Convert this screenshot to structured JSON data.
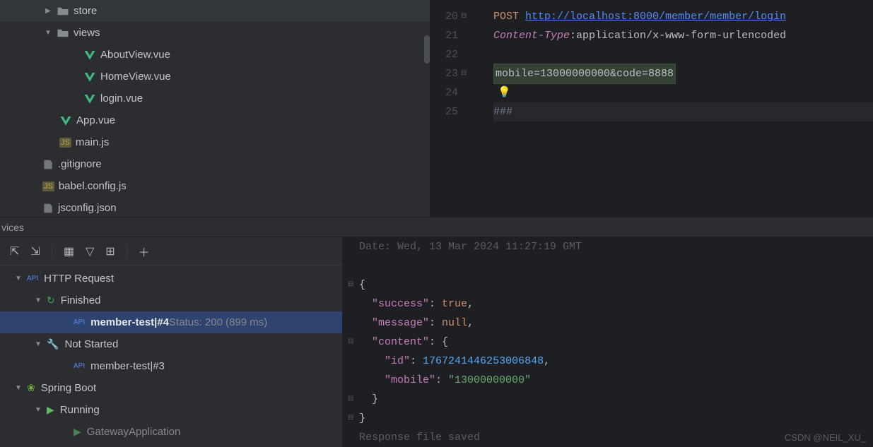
{
  "tree": {
    "store": "store",
    "views": "views",
    "about": "AboutView.vue",
    "home": "HomeView.vue",
    "login": "login.vue",
    "app": "App.vue",
    "main": "main.js",
    "gitignore": ".gitignore",
    "babel": "babel.config.js",
    "jsconfig": "jsconfig.json"
  },
  "editor": {
    "lines": [
      "20",
      "21",
      "22",
      "23",
      "24",
      "25"
    ],
    "method": "POST",
    "url": "http://localhost:8000/member/member/login",
    "header_name": "Content-Type",
    "header_sep": ": ",
    "header_value": "application/x-www-form-urlencoded",
    "body": "mobile=13000000000&code=8888",
    "terminator": "###"
  },
  "panel_title": "vices",
  "services": {
    "http": "HTTP Request",
    "finished": "Finished",
    "test_name": "member-test",
    "test_sep": "  |  ",
    "test_num": "#4",
    "test_status": " Status: 200 (899 ms)",
    "notstarted": "Not Started",
    "test2_name": "member-test",
    "test2_num": "#3",
    "spring": "Spring Boot",
    "running": "Running",
    "gateway": "GatewayApplication"
  },
  "response": {
    "date": "Date: Wed, 13 Mar 2024 11:27:19 GMT",
    "brace_open": "{",
    "success_k": "\"success\"",
    "success_v": "true",
    "message_k": "\"message\"",
    "message_v": "null",
    "content_k": "\"content\"",
    "content_open": "{",
    "id_k": "\"id\"",
    "id_v": "1767241446253006848",
    "mobile_k": "\"mobile\"",
    "mobile_v": "\"13000000000\"",
    "content_close": "}",
    "brace_close": "}",
    "saved": "Response file saved"
  },
  "watermark": "CSDN @NEIL_XU_",
  "chart_data": {
    "type": "table",
    "http_request": {
      "method": "POST",
      "url": "http://localhost:8000/member/member/login",
      "headers": {
        "Content-Type": "application/x-www-form-urlencoded"
      },
      "body": "mobile=13000000000&code=8888"
    },
    "http_response": {
      "date": "Wed, 13 Mar 2024 11:27:19 GMT",
      "status": 200,
      "time_ms": 899,
      "body": {
        "success": true,
        "message": null,
        "content": {
          "id": 1767241446253006848,
          "mobile": "13000000000"
        }
      }
    }
  }
}
